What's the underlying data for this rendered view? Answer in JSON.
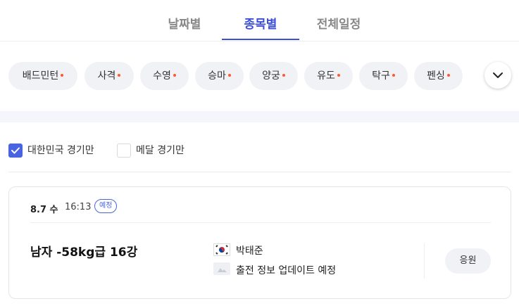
{
  "tabs": [
    {
      "label": "날짜별"
    },
    {
      "label": "종목별"
    },
    {
      "label": "전체일정"
    }
  ],
  "active_tab": "종목별",
  "sports": [
    {
      "label": "배드민턴"
    },
    {
      "label": "사격"
    },
    {
      "label": "수영"
    },
    {
      "label": "승마"
    },
    {
      "label": "양궁"
    },
    {
      "label": "유도"
    },
    {
      "label": "탁구"
    },
    {
      "label": "펜싱"
    }
  ],
  "filters": {
    "korea_only": {
      "label": "대한민국 경기만",
      "checked": true
    },
    "medal_only": {
      "label": "메달 경기만",
      "checked": false
    }
  },
  "match": {
    "date": "8.7 수",
    "time": "16:13",
    "status": "예정",
    "event": "남자 -58kg급 16강",
    "athlete": "박태준",
    "opponent_status": "출전 정보 업데이트 예정",
    "cheer_label": "응원"
  },
  "colors": {
    "accent": "#3d4fd6",
    "dot": "#ff5a2a",
    "chip_bg": "#f1f2f6"
  }
}
